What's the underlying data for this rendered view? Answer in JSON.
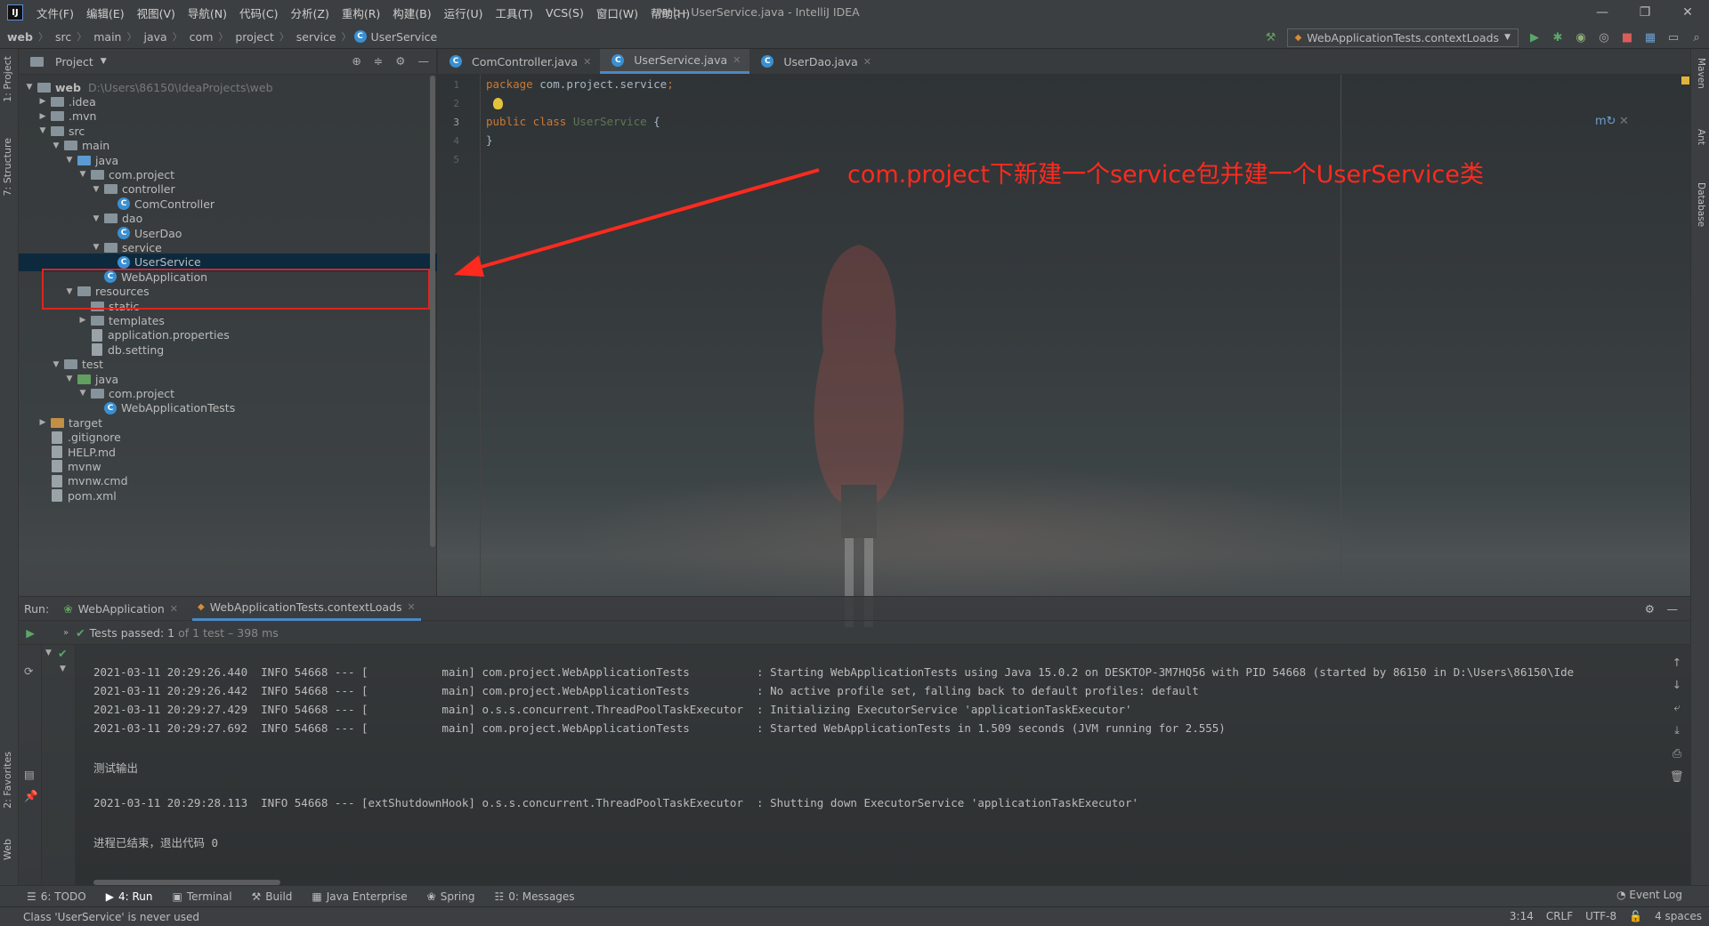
{
  "window": {
    "title": "web - UserService.java - IntelliJ IDEA",
    "logo": "IJ"
  },
  "menu": [
    "文件(F)",
    "编辑(E)",
    "视图(V)",
    "导航(N)",
    "代码(C)",
    "分析(Z)",
    "重构(R)",
    "构建(B)",
    "运行(U)",
    "工具(T)",
    "VCS(S)",
    "窗口(W)",
    "帮助(H)"
  ],
  "breadcrumb": [
    "web",
    "src",
    "main",
    "java",
    "com",
    "project",
    "service",
    "UserService"
  ],
  "run_config": "WebApplicationTests.contextLoads",
  "left_tabs": [
    "1: Project",
    "7: Structure",
    "2: Favorites",
    "Web"
  ],
  "right_tabs": [
    "Maven",
    "Ant",
    "Database"
  ],
  "project_panel": {
    "title": "Project",
    "tree": [
      {
        "label": "web",
        "hint": "D:\\Users\\86150\\IdeaProjects\\web",
        "arrow": "▼",
        "icon": "folder"
      },
      {
        "label": ".idea",
        "arrow": "▶",
        "icon": "folder"
      },
      {
        "label": ".mvn",
        "arrow": "▶",
        "icon": "folder"
      },
      {
        "label": "src",
        "arrow": "▼",
        "icon": "folder"
      },
      {
        "label": "main",
        "arrow": "▼",
        "icon": "folder"
      },
      {
        "label": "java",
        "arrow": "▼",
        "icon": "folder-blue"
      },
      {
        "label": "com.project",
        "arrow": "▼",
        "icon": "package"
      },
      {
        "label": "controller",
        "arrow": "▼",
        "icon": "package"
      },
      {
        "label": "ComController",
        "arrow": "",
        "icon": "class"
      },
      {
        "label": "dao",
        "arrow": "▼",
        "icon": "package"
      },
      {
        "label": "UserDao",
        "arrow": "",
        "icon": "class"
      },
      {
        "label": "service",
        "arrow": "▼",
        "icon": "package"
      },
      {
        "label": "UserService",
        "arrow": "",
        "icon": "class"
      },
      {
        "label": "WebApplication",
        "arrow": "",
        "icon": "class"
      },
      {
        "label": "resources",
        "arrow": "▼",
        "icon": "folder"
      },
      {
        "label": "static",
        "arrow": "",
        "icon": "folder"
      },
      {
        "label": "templates",
        "arrow": "▶",
        "icon": "folder"
      },
      {
        "label": "application.properties",
        "arrow": "",
        "icon": "file"
      },
      {
        "label": "db.setting",
        "arrow": "",
        "icon": "file"
      },
      {
        "label": "test",
        "arrow": "▼",
        "icon": "folder"
      },
      {
        "label": "java",
        "arrow": "▼",
        "icon": "folder-green"
      },
      {
        "label": "com.project",
        "arrow": "▼",
        "icon": "package"
      },
      {
        "label": "WebApplicationTests",
        "arrow": "",
        "icon": "class"
      },
      {
        "label": "target",
        "arrow": "▶",
        "icon": "folder-orange"
      },
      {
        "label": ".gitignore",
        "arrow": "",
        "icon": "file"
      },
      {
        "label": "HELP.md",
        "arrow": "",
        "icon": "file"
      },
      {
        "label": "mvnw",
        "arrow": "",
        "icon": "file"
      },
      {
        "label": "mvnw.cmd",
        "arrow": "",
        "icon": "file"
      },
      {
        "label": "pom.xml",
        "arrow": "",
        "icon": "file"
      }
    ]
  },
  "editor": {
    "tabs": [
      {
        "label": "ComController.java",
        "active": false
      },
      {
        "label": "UserService.java",
        "active": true
      },
      {
        "label": "UserDao.java",
        "active": false
      }
    ],
    "line_numbers": [
      "1",
      "2",
      "3",
      "4",
      "5"
    ],
    "code": {
      "l1_kw": "package",
      "l1_rest": " com.project.service",
      "l1_semi": ";",
      "l3_kw": "public class",
      "l3_cls": "UserService",
      "l3_rest": " {",
      "l4": "}"
    }
  },
  "annotation": "com.project下新建一个service包并建一个UserService类",
  "run_panel": {
    "label": "Run:",
    "tabs": [
      {
        "label": "WebApplication",
        "active": false
      },
      {
        "label": "WebApplicationTests.contextLoads",
        "active": true
      }
    ],
    "tests_status": "Tests passed:",
    "tests_count": "1",
    "tests_detail": "of 1 test – 398 ms",
    "console": [
      "2021-03-11 20:29:26.440  INFO 54668 --- [           main] com.project.WebApplicationTests          : Starting WebApplicationTests using Java 15.0.2 on DESKTOP-3M7HQ56 with PID 54668 (started by 86150 in D:\\Users\\86150\\Ide",
      "2021-03-11 20:29:26.442  INFO 54668 --- [           main] com.project.WebApplicationTests          : No active profile set, falling back to default profiles: default",
      "2021-03-11 20:29:27.429  INFO 54668 --- [           main] o.s.s.concurrent.ThreadPoolTaskExecutor  : Initializing ExecutorService 'applicationTaskExecutor'",
      "2021-03-11 20:29:27.692  INFO 54668 --- [           main] com.project.WebApplicationTests          : Started WebApplicationTests in 1.509 seconds (JVM running for 2.555)",
      "",
      "测试输出",
      "",
      "2021-03-11 20:29:28.113  INFO 54668 --- [extShutdownHook] o.s.s.concurrent.ThreadPoolTaskExecutor  : Shutting down ExecutorService 'applicationTaskExecutor'",
      "",
      "进程已结束，退出代码 0"
    ]
  },
  "bottom_tools": [
    {
      "label": "6: TODO",
      "active": false
    },
    {
      "label": "4: Run",
      "active": true
    },
    {
      "label": "Terminal",
      "active": false
    },
    {
      "label": "Build",
      "active": false
    },
    {
      "label": "Java Enterprise",
      "active": false
    },
    {
      "label": "Spring",
      "active": false
    },
    {
      "label": "0: Messages",
      "active": false
    }
  ],
  "event_log": "Event Log",
  "status": {
    "message": "Class 'UserService' is never used",
    "position": "3:14",
    "line_sep": "CRLF",
    "encoding": "UTF-8",
    "indent": "4 spaces"
  },
  "colors": {
    "accent": "#4a88c7",
    "annotation": "#ff2a1e",
    "keyword": "#cc7832",
    "selection": "#0d293e"
  }
}
